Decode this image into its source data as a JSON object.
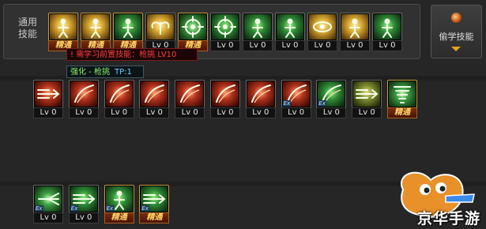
{
  "general": {
    "label": "通用技能"
  },
  "steal_button": {
    "label": "偷学技能",
    "icon": "orb-icon"
  },
  "tooltip": {
    "requirement": "! 需学习前置技能：枪挑 LV10",
    "enhance": "强化 - 枪挑",
    "tp": "TP:1"
  },
  "row1": [
    {
      "icon": "rest-icon",
      "tint": "yellow",
      "level": "精通",
      "mastered": true
    },
    {
      "icon": "flame-fist-icon",
      "tint": "yellow",
      "level": "精通",
      "mastered": true
    },
    {
      "icon": "sprint-icon",
      "tint": "green",
      "level": "精通",
      "mastered": true
    },
    {
      "icon": "wings-icon",
      "tint": "yellow",
      "level": "Lv 0",
      "mastered": false
    },
    {
      "icon": "crosshair-icon",
      "tint": "green2",
      "level": "精通",
      "mastered": true
    },
    {
      "icon": "target-icon",
      "tint": "green",
      "level": "Lv 0",
      "mastered": false
    },
    {
      "icon": "meditate-icon",
      "tint": "green",
      "level": "Lv 0",
      "mastered": false
    },
    {
      "icon": "gear-figure-icon",
      "tint": "green",
      "level": "Lv 0",
      "mastered": false
    },
    {
      "icon": "eye-icon",
      "tint": "yellow",
      "level": "Lv 0",
      "mastered": false
    },
    {
      "icon": "strength-icon",
      "tint": "yellow",
      "level": "Lv 0",
      "mastered": false
    },
    {
      "icon": "kick-icon",
      "tint": "green",
      "level": "Lv 0",
      "mastered": false
    }
  ],
  "row2": [
    {
      "icon": "spear-thrust-icon",
      "tint": "red",
      "level": "Lv 0",
      "mastered": false,
      "ex": false
    },
    {
      "icon": "slash-icon",
      "tint": "red",
      "level": "Lv 0",
      "mastered": false,
      "ex": false
    },
    {
      "icon": "swing-icon",
      "tint": "red",
      "level": "Lv 0",
      "mastered": false,
      "ex": false
    },
    {
      "icon": "arc-slash-icon",
      "tint": "red",
      "level": "Lv 0",
      "mastered": false,
      "ex": false
    },
    {
      "icon": "cross-slash-icon",
      "tint": "red",
      "level": "Lv 0",
      "mastered": false,
      "ex": false
    },
    {
      "icon": "sweep-icon",
      "tint": "red",
      "level": "Lv 0",
      "mastered": false,
      "ex": false
    },
    {
      "icon": "crescent-icon",
      "tint": "red",
      "level": "Lv 0",
      "mastered": false,
      "ex": false
    },
    {
      "icon": "blade-wave-icon",
      "tint": "red",
      "level": "Lv 0",
      "mastered": false,
      "ex": true
    },
    {
      "icon": "wind-blade-icon",
      "tint": "green",
      "level": "Lv 0",
      "mastered": false,
      "ex": true
    },
    {
      "icon": "lunge-icon",
      "tint": "olive",
      "level": "Lv 0",
      "mastered": false,
      "ex": false
    },
    {
      "icon": "tornado-icon",
      "tint": "green2",
      "level": "精通",
      "mastered": true,
      "ex": false
    }
  ],
  "row3": [
    {
      "icon": "burst-icon",
      "tint": "green2",
      "level": "Lv 0",
      "mastered": false,
      "ex": true
    },
    {
      "icon": "speed-lines-icon",
      "tint": "green",
      "level": "Lv 0",
      "mastered": false,
      "ex": true
    },
    {
      "icon": "leap-strike-icon",
      "tint": "green",
      "level": "精通",
      "mastered": true,
      "ex": true
    },
    {
      "icon": "dash-icon",
      "tint": "green",
      "level": "精通",
      "mastered": true,
      "ex": true
    }
  ],
  "watermark": {
    "text": "京华手游"
  }
}
